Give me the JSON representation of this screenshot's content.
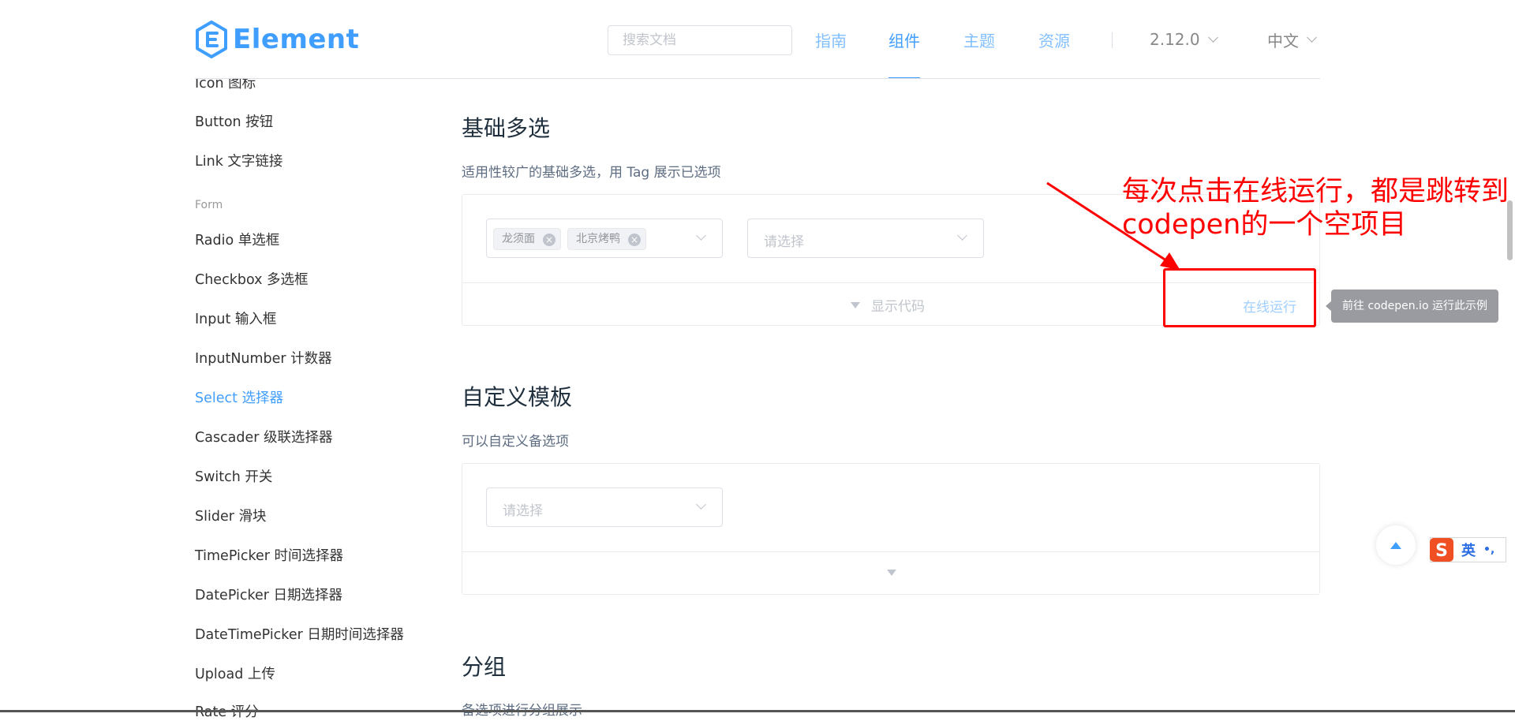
{
  "header": {
    "logo_text": "Element",
    "search_placeholder": "搜索文档",
    "nav": [
      "指南",
      "组件",
      "主题",
      "资源"
    ],
    "active_nav": "组件",
    "version": "2.12.0",
    "language": "中文"
  },
  "sidebar": {
    "items": [
      {
        "label": "Icon 图标"
      },
      {
        "label": "Button 按钮"
      },
      {
        "label": "Link 文字链接"
      },
      {
        "label": "Radio 单选框"
      },
      {
        "label": "Checkbox 多选框"
      },
      {
        "label": "Input 输入框"
      },
      {
        "label": "InputNumber 计数器"
      },
      {
        "label": "Select 选择器",
        "active": true
      },
      {
        "label": "Cascader 级联选择器"
      },
      {
        "label": "Switch 开关"
      },
      {
        "label": "Slider 滑块"
      },
      {
        "label": "TimePicker 时间选择器"
      },
      {
        "label": "DatePicker 日期选择器"
      },
      {
        "label": "DateTimePicker 日期时间选择器"
      },
      {
        "label": "Upload 上传"
      },
      {
        "label": "Rate 评分"
      }
    ],
    "group_form": "Form"
  },
  "sections": [
    {
      "title": "基础多选",
      "description": "适用性较广的基础多选，用 Tag 展示已选项",
      "tags": [
        "龙须面",
        "北京烤鸭"
      ],
      "placeholder": "请选择",
      "show_code": "显示代码",
      "run_online": "在线运行"
    },
    {
      "title": "自定义模板",
      "description": "可以自定义备选项",
      "placeholder": "请选择"
    },
    {
      "title": "分组",
      "description": "备选项进行分组展示"
    }
  ],
  "tooltip": "前往 codepen.io 运行此示例",
  "annotation": {
    "line1": "每次点击在线运行，都是跳转到",
    "line2": "codepen的一个空项目",
    "color": "#ff0000"
  },
  "ime": {
    "label": "英",
    "punct": "•,"
  },
  "colors": {
    "primary": "#409eff",
    "text": "#303133",
    "placeholder": "#c0c4cc"
  }
}
